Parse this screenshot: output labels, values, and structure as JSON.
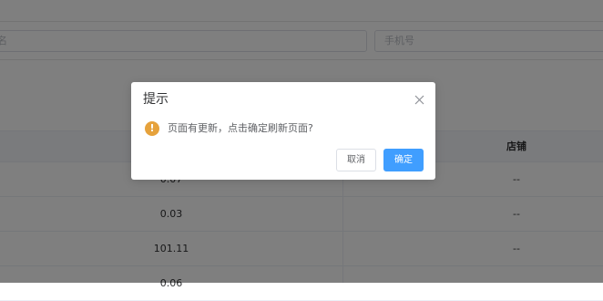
{
  "filters": {
    "left_placeholder": "名",
    "phone_placeholder": "手机号"
  },
  "table": {
    "header_shop": "店铺",
    "rows": [
      {
        "amount": "0.07",
        "shop": "--"
      },
      {
        "amount": "0.03",
        "shop": "--"
      },
      {
        "amount": "101.11",
        "shop": "--"
      },
      {
        "amount": "0.06",
        "shop": ""
      }
    ]
  },
  "dialog": {
    "title": "提示",
    "message": "页面有更新，点击确定刷新页面?",
    "cancel_label": "取消",
    "confirm_label": "确定",
    "icon": "warning-icon",
    "icon_glyph": "!",
    "icon_color": "#e6a23c",
    "primary_color": "#409eff"
  }
}
